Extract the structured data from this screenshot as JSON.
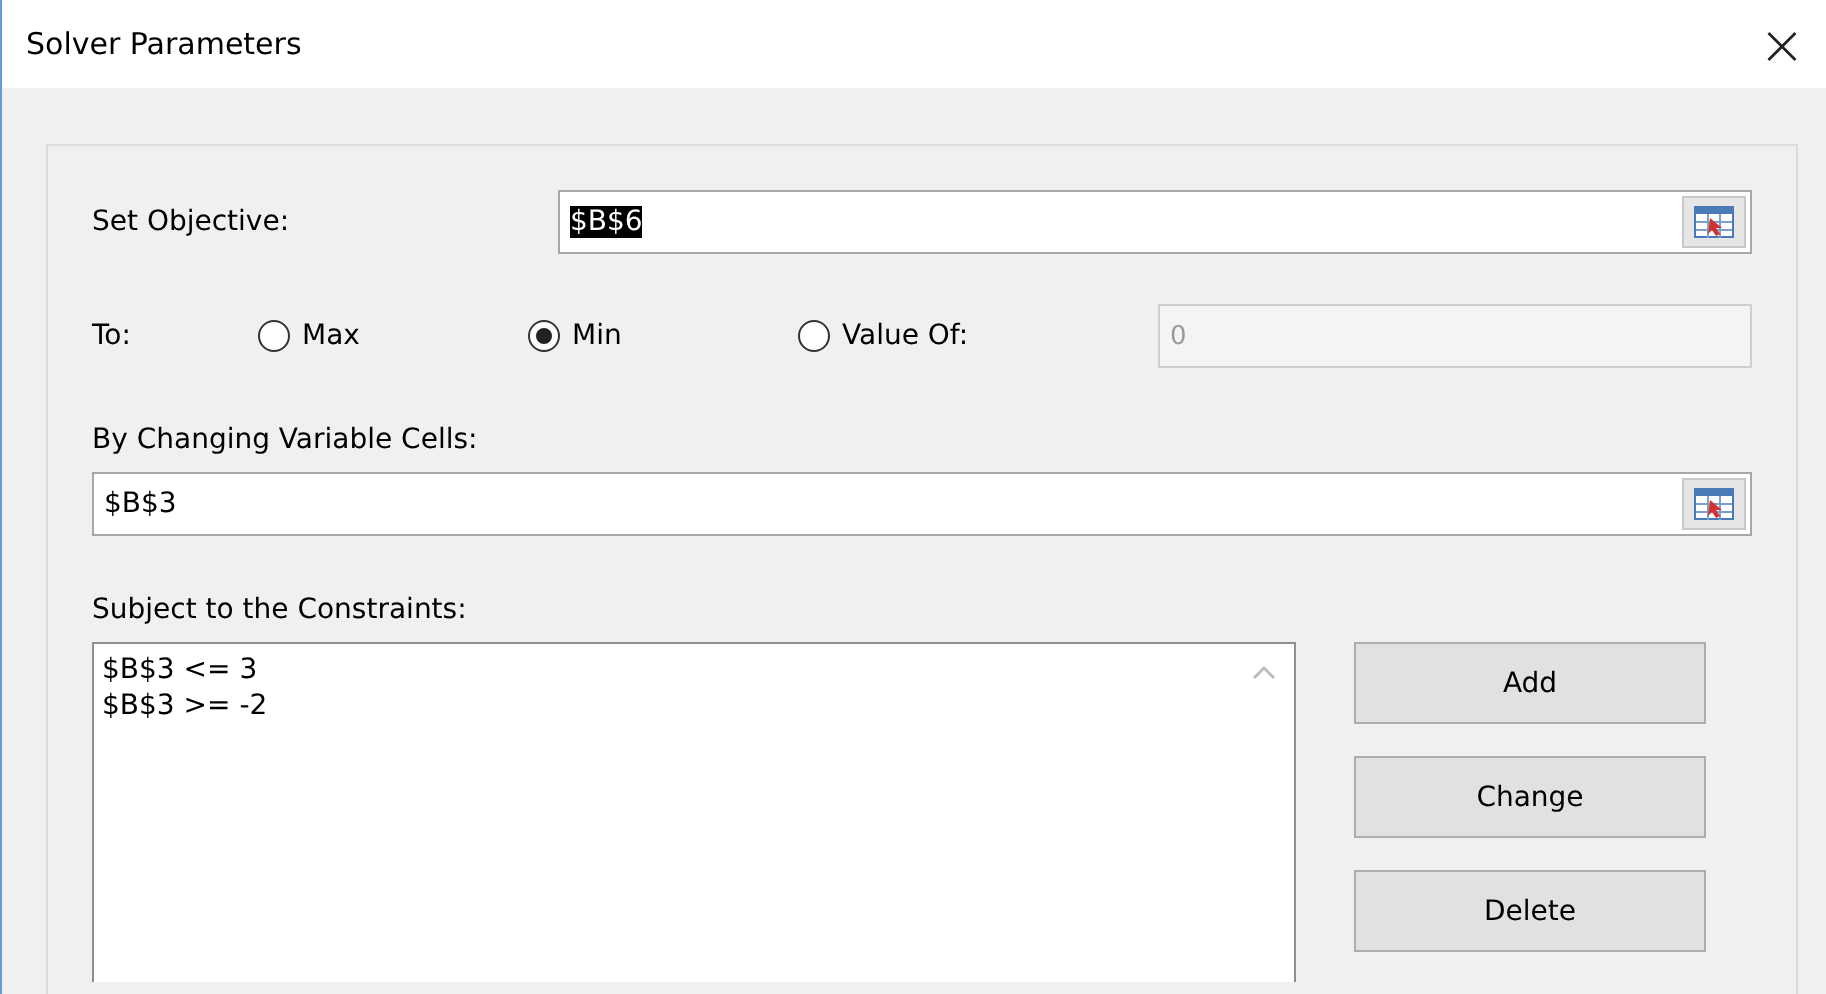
{
  "window": {
    "title": "Solver Parameters",
    "close": "×"
  },
  "objective": {
    "label": "Set Objective:",
    "value": "$B$6",
    "value_selected": true
  },
  "to": {
    "label": "To:",
    "options": [
      {
        "label": "Max",
        "selected": false
      },
      {
        "label": "Min",
        "selected": true
      },
      {
        "label": "Value Of:",
        "selected": false
      }
    ],
    "value_field": {
      "value": "0",
      "disabled": true
    }
  },
  "variable_cells": {
    "label": "By Changing Variable Cells:",
    "value": "$B$3"
  },
  "constraints": {
    "label": "Subject to the Constraints:",
    "items": [
      "$B$3 <= 3",
      "$B$3 >= -2"
    ]
  },
  "buttons": [
    {
      "label": "Add"
    },
    {
      "label": "Change"
    },
    {
      "label": "Delete"
    }
  ]
}
